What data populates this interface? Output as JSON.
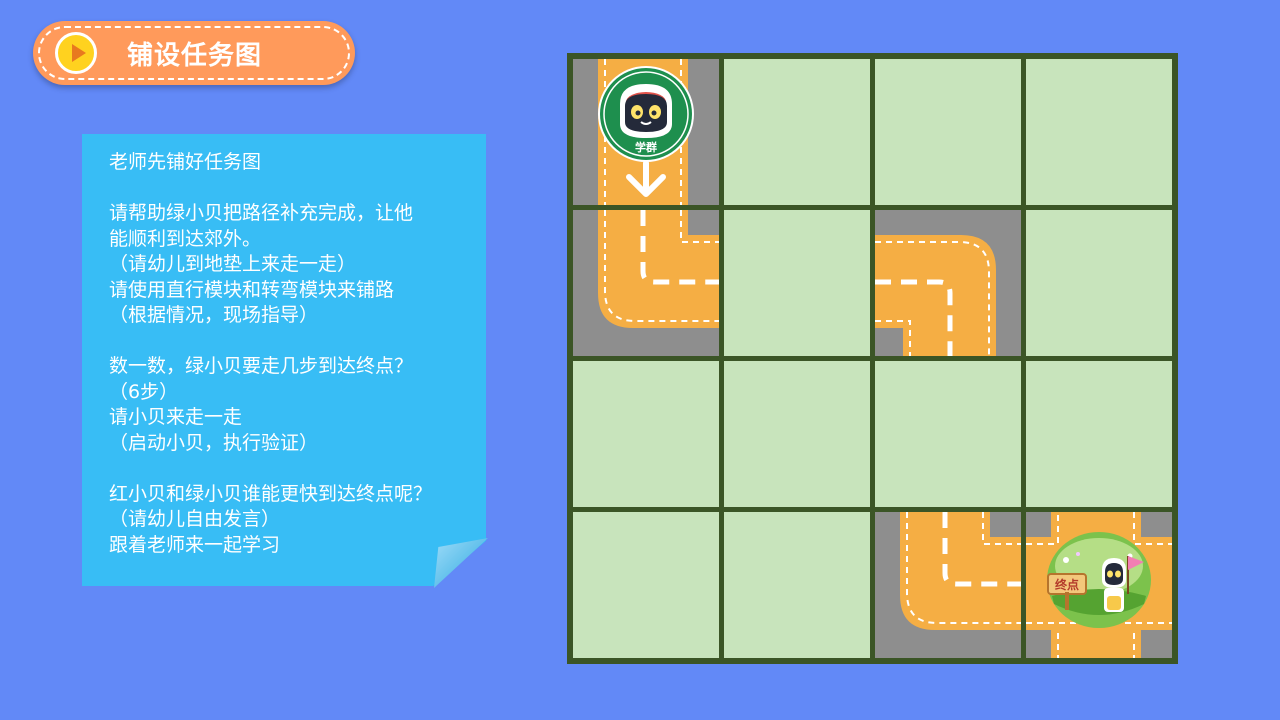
{
  "header": {
    "title": "铺设任务图",
    "play_icon": "play-icon"
  },
  "note": {
    "lines": [
      "老师先铺好任务图",
      "",
      "请帮助绿小贝把路径补充完成，让他",
      "能顺利到达郊外。",
      "（请幼儿到地垫上来走一走）",
      "请使用直行模块和转弯模块来铺路",
      "（根据情况，现场指导）",
      "",
      "数一数，绿小贝要走几步到达终点？",
      "（6步）",
      "请小贝来走一走",
      "（启动小贝，执行验证）",
      "",
      "红小贝和绿小贝谁能更快到达终点呢？",
      "（请幼儿自由发言）",
      "跟着老师来一起学习"
    ]
  },
  "board": {
    "start_badge": "学群",
    "end_badge": "终点",
    "colors": {
      "grass": "#c8e4bc",
      "road": "#f5ae44",
      "asphalt": "#8e8e8e",
      "grid": "#3b5526",
      "robot_green": "#1e8f4e"
    }
  }
}
